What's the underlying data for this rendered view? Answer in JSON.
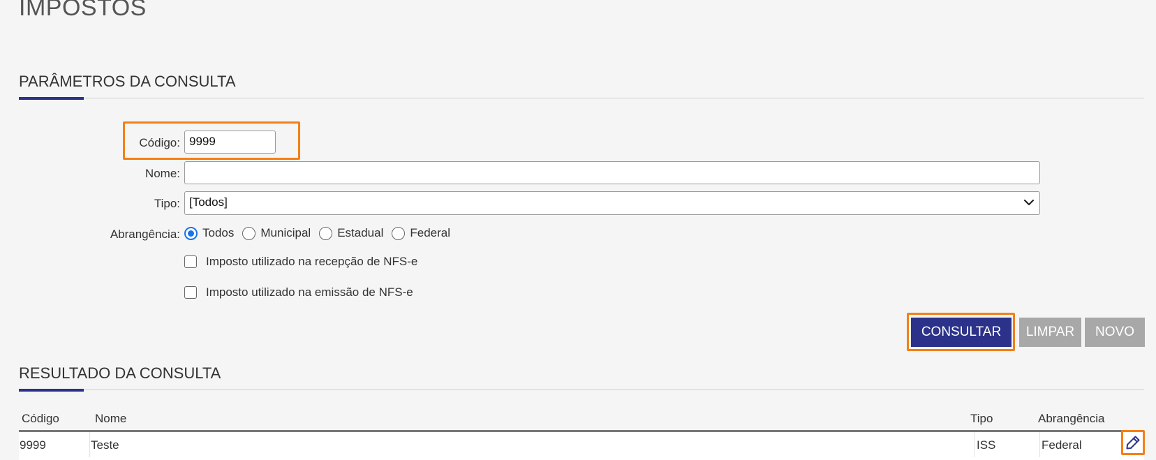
{
  "page": {
    "title": "IMPOSTOS"
  },
  "params": {
    "section_title": "PARÂMETROS DA CONSULTA",
    "codigo_label": "Código:",
    "codigo_value": "9999",
    "nome_label": "Nome:",
    "nome_value": "",
    "tipo_label": "Tipo:",
    "tipo_value": "[Todos]",
    "abrangencia_label": "Abrangência:",
    "abrangencia_options": [
      {
        "label": "Todos",
        "checked": true
      },
      {
        "label": "Municipal",
        "checked": false
      },
      {
        "label": "Estadual",
        "checked": false
      },
      {
        "label": "Federal",
        "checked": false
      }
    ],
    "check_recepcao_label": "Imposto utilizado na recepção de NFS-e",
    "check_emissao_label": "Imposto utilizado na emissão de NFS-e"
  },
  "buttons": {
    "consultar": "CONSULTAR",
    "limpar": "LIMPAR",
    "novo": "NOVO"
  },
  "results": {
    "section_title": "RESULTADO DA CONSULTA",
    "columns": {
      "codigo": "Código",
      "nome": "Nome",
      "tipo": "Tipo",
      "abrangencia": "Abrangência"
    },
    "rows": [
      {
        "codigo": "9999",
        "nome": "Teste",
        "tipo": "ISS",
        "abrangencia": "Federal",
        "action_icon": "pencil-icon"
      }
    ]
  },
  "colors": {
    "primary": "#2c3289",
    "highlight": "#f57f17",
    "radio_checked": "#1a73e8",
    "button_gray": "#a8a8a8"
  }
}
